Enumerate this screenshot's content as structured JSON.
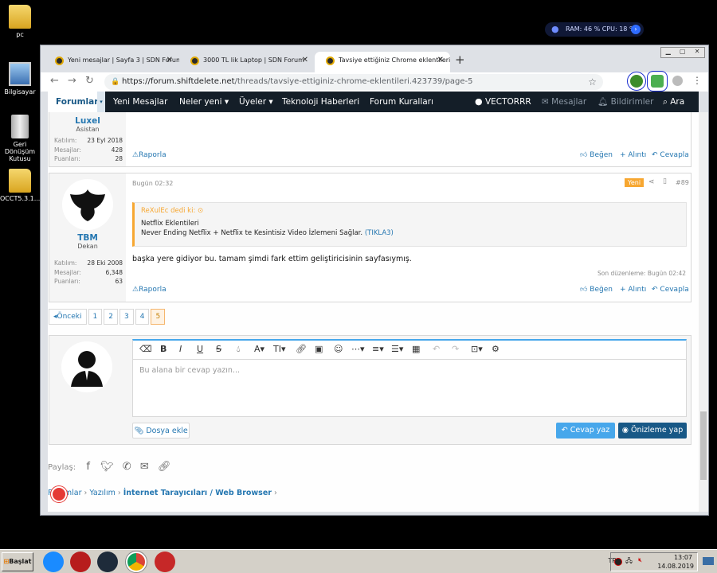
{
  "desktop": {
    "icons": [
      {
        "label": "pc"
      },
      {
        "label": "Bilgisayar"
      },
      {
        "label": "Geri Dönüşüm Kutusu"
      },
      {
        "label": "OCCT5.3.1..."
      }
    ]
  },
  "sysmon": {
    "text": "RAM: 46 % CPU: 18 %"
  },
  "browser": {
    "tabs": [
      {
        "label": "Yeni mesajlar | Sayfa 3 | SDN Forum"
      },
      {
        "label": "3000 TL lik Laptop | SDN Forum"
      },
      {
        "label": "Tavsiye ettiğiniz Chrome eklentileri |"
      }
    ],
    "url_host": "https://forum.shiftdelete.net",
    "url_path": "/threads/tavsiye-ettiginiz-chrome-eklentileri.423739/page-5"
  },
  "nav": {
    "forums": "Forumlar",
    "new_posts": "Yeni Mesajlar",
    "whats_new": "Neler yeni",
    "members": "Üyeler",
    "tech_news": "Teknoloji Haberleri",
    "rules": "Forum Kuralları",
    "user": "VECTORRR",
    "messages": "Mesajlar",
    "alerts": "Bildirimler",
    "search": "Ara"
  },
  "post1": {
    "name": "Luxel",
    "role": "Asistan",
    "stats": [
      {
        "k": "Katılım:",
        "v": "23 Eyl 2018"
      },
      {
        "k": "Mesajlar:",
        "v": "428"
      },
      {
        "k": "Puanları:",
        "v": "28"
      }
    ],
    "report": "Raporla",
    "like": "Beğen",
    "quote": "+ Alıntı",
    "reply": "Cevapla"
  },
  "post2": {
    "name": "TBM",
    "role": "Dekan",
    "stats": [
      {
        "k": "Katılım:",
        "v": "28 Eki 2008"
      },
      {
        "k": "Mesajlar:",
        "v": "6,348"
      },
      {
        "k": "Puanları:",
        "v": "63"
      }
    ],
    "time": "Bugün 02:32",
    "new_badge": "Yeni",
    "number": "#89",
    "quote_author": "ReXulEc dedi ki:",
    "quote_line1": "Netflix Eklentileri",
    "quote_line2": "Never Ending Netflix + Netflix te Kesintisiz Video İzlemeni Sağlar.",
    "quote_link": "(TIKLA3)",
    "body": "başka yere gidiyor bu. tamam şimdi fark ettim geliştiricisinin sayfasıymış.",
    "edited": "Son düzenleme: Bugün 02:42",
    "report": "Raporla",
    "like": "Beğen",
    "quote": "+ Alıntı",
    "reply": "Cevapla"
  },
  "pager": {
    "prev": "◂Önceki",
    "pages": [
      "1",
      "2",
      "3",
      "4",
      "5"
    ]
  },
  "editor": {
    "placeholder": "Bu alana bir cevap yazın...",
    "attach": "Dosya ekle",
    "submit": "Cevap yaz",
    "preview": "Önizleme yap"
  },
  "share": {
    "label": "Paylaş:"
  },
  "breadcrumb": {
    "items": [
      "Forumlar",
      "Yazılım",
      "İnternet Tarayıcıları / Web Browser"
    ]
  },
  "taskbar": {
    "start": "Başlat",
    "lang": "TR",
    "time": "13:07",
    "date": "14.08.2019"
  }
}
